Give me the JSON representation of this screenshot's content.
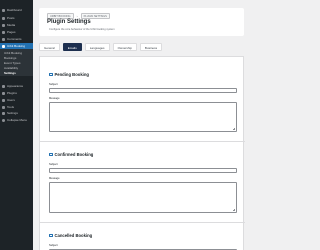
{
  "sidebar": {
    "items": [
      {
        "label": "Dashboard"
      },
      {
        "label": "Posts"
      },
      {
        "label": "Media"
      },
      {
        "label": "Pages"
      },
      {
        "label": "Comments"
      },
      {
        "label": "Urbit Booking"
      },
      {
        "label": "Appearance"
      },
      {
        "label": "Plugins"
      },
      {
        "label": "Users"
      },
      {
        "label": "Tools"
      },
      {
        "label": "Settings"
      },
      {
        "label": "Collapse Menu"
      }
    ],
    "submenu": [
      {
        "label": "Urbit Booking"
      },
      {
        "label": "Bookings"
      },
      {
        "label": "Event Types"
      },
      {
        "label": "Availability"
      },
      {
        "label": "Settings"
      }
    ]
  },
  "header": {
    "breadcrumbs": [
      "URBIT BOOKING",
      "PLUGIN SETTINGS"
    ],
    "separator": "›",
    "title": "Plugin Settings",
    "subtitle": "Configure the core behaviour of the Urbit booking system"
  },
  "tabs": [
    "General",
    "Emails",
    "Languages",
    "Ownership",
    "Business"
  ],
  "active_tab": "Emails",
  "sections": [
    {
      "title": "Pending Booking",
      "subject_label": "Subject",
      "message_label": "Message"
    },
    {
      "title": "Confirmed Booking",
      "subject_label": "Subject",
      "message_label": "Message"
    },
    {
      "title": "Cancelled Booking",
      "subject_label": "Subject"
    }
  ],
  "colors": {
    "sidebar_bg": "#1d2327",
    "accent": "#2271b1",
    "active_tab": "#1d2f4f",
    "page_bg": "#f0f0f1"
  }
}
